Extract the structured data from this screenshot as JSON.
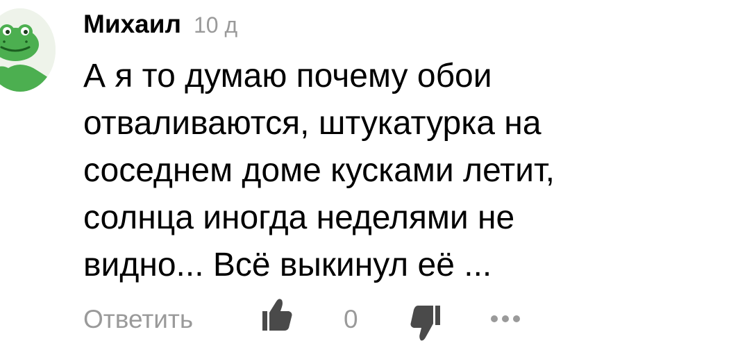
{
  "comment": {
    "author": "Михаил",
    "time": "10 д",
    "text_lines": [
      "А я то думаю почему обои",
      "отваливаются, штукатурка на",
      "соседнем доме кусками летит,",
      "солнца иногда неделями не",
      "видно... Всё выкинул её ..."
    ],
    "actions": {
      "reply_label": "Ответить",
      "like_count": "0"
    },
    "icons": {
      "avatar": "frog-avatar-icon",
      "like": "thumbs-up-icon",
      "dislike": "thumbs-down-icon",
      "more": "more-dots-icon"
    },
    "colors": {
      "text": "#000000",
      "muted": "#9a9a9a",
      "avatar_green": "#4caf50"
    }
  }
}
